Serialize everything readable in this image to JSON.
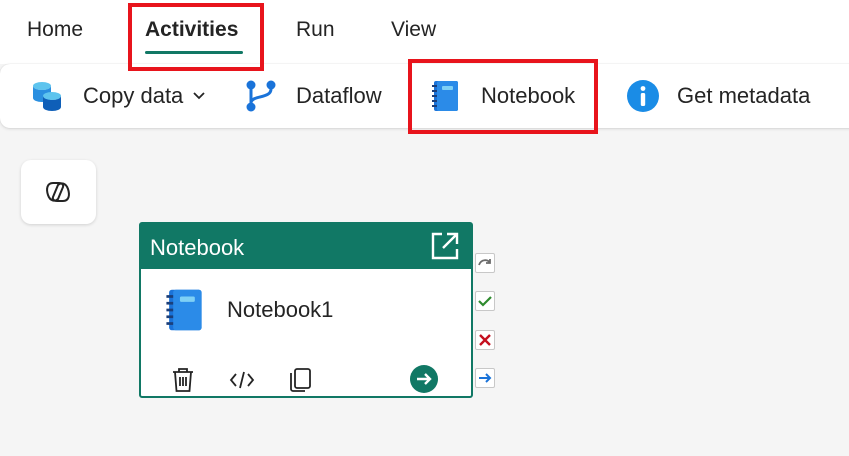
{
  "tabs": [
    {
      "label": "Home"
    },
    {
      "label": "Activities",
      "active": true
    },
    {
      "label": "Run"
    },
    {
      "label": "View"
    }
  ],
  "ribbon": {
    "copy_data": {
      "label": "Copy data",
      "icon": "database-icon"
    },
    "dataflow": {
      "label": "Dataflow",
      "icon": "dataflow-branch-icon"
    },
    "notebook": {
      "label": "Notebook",
      "icon": "notebook-icon"
    },
    "get_metadata": {
      "label": "Get metadata",
      "icon": "info-icon"
    }
  },
  "card": {
    "title": "Notebook",
    "name": "Notebook1",
    "actions": [
      "delete-icon",
      "code-icon",
      "copy-icon",
      "go-arrow-icon"
    ]
  },
  "ports": [
    "skip-icon",
    "success-check-icon",
    "fail-x-icon",
    "completion-arrow-icon"
  ],
  "colors": {
    "accent": "#117865",
    "highlight": "#e8141c",
    "notebook_blue": "#1a73d9",
    "info_blue": "#1a8ce6"
  }
}
